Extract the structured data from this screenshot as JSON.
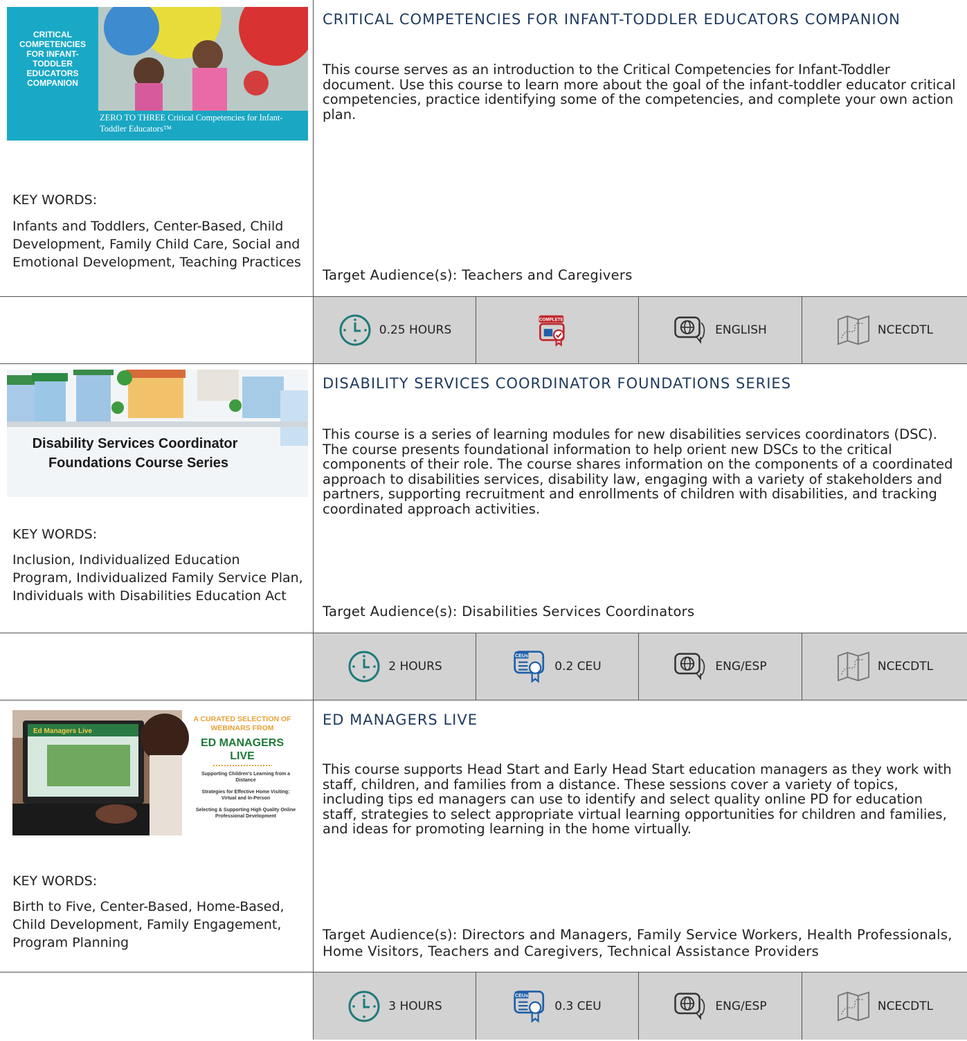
{
  "courses": [
    {
      "thumb": {
        "heading": [
          "CRITICAL",
          "COMPETENCIES",
          "FOR INFANT-",
          "TODDLER",
          "EDUCATORS",
          "COMPANION"
        ],
        "caption": "ZERO TO THREE Critical Competencies for Infant-Toddler Educators™"
      },
      "title": "CRITICAL COMPETENCIES FOR INFANT-TODDLER EDUCATORS COMPANION",
      "description": "This course serves as an introduction to the Critical Competencies for Infant-Toddler document. Use this course to learn more about the goal of the infant-toddler educator critical competencies, practice identifying some of the competencies, and complete your own action plan.",
      "keywords_label": "KEY WORDS:",
      "keywords": "Infants and Toddlers, Center-Based, Child Development, Family Child Care, Social and Emotional Development, Teaching Practices",
      "audience": "Target Audience(s): Teachers and Caregivers",
      "meta": {
        "hours": "0.25 HOURS",
        "credit": "",
        "credit_badge": "COMPLETE",
        "language": "ENGLISH",
        "provider": "NCECDTL"
      }
    },
    {
      "thumb": {
        "heading": [
          "Disability Services Coordinator",
          "Foundations Course Series"
        ]
      },
      "title": "DISABILITY SERVICES COORDINATOR FOUNDATIONS SERIES",
      "description": "This course is a series of learning modules for new disabilities services coordinators (DSC). The course presents foundational information to help orient new DSCs to the critical components of their role. The course shares information on the components of a coordinated approach to disabilities services, disability law, engaging with a variety of stakeholders and partners, supporting recruitment and enrollments of children with disabilities, and tracking coordinated approach activities.",
      "keywords_label": "KEY WORDS:",
      "keywords": "Inclusion, Individualized Education Program, Individualized Family Service Plan, Individuals with Disabilities Education Act",
      "audience": "Target Audience(s): Disabilities Services Coordinators",
      "meta": {
        "hours": "2 HOURS",
        "credit": "0.2 CEU",
        "credit_badge": "CEUs",
        "language": "ENG/ESP",
        "provider": "NCECDTL"
      }
    },
    {
      "thumb": {
        "heading": [
          "A CURATED SELECTION OF",
          "WEBINARS FROM",
          "ED MANAGERS",
          "LIVE"
        ],
        "items": [
          "Supporting Children's Learning from a Distance",
          "Strategies for Effective Home Visiting: Virtual and In-Person",
          "Selecting & Supporting High Quality Online Professional Development"
        ],
        "screen_label": "Ed Managers Live"
      },
      "title": "ED MANAGERS LIVE",
      "description": "This course supports Head Start and Early Head Start education managers as they work with staff, children, and families from a distance. These sessions cover a variety of topics, including tips ed managers can use to identify and select quality online PD for education staff, strategies to select appropriate virtual learning opportunities for children and families, and ideas for promoting learning in the home virtually.",
      "keywords_label": "KEY WORDS:",
      "keywords": "Birth to Five, Center-Based, Home-Based, Child Development, Family Engagement, Program Planning",
      "audience": "Target Audience(s): Directors and Managers, Family Service Workers, Health Professionals, Home Visitors, Teachers and Caregivers, Technical Assistance Providers",
      "meta": {
        "hours": "3 HOURS",
        "credit": "0.3 CEU",
        "credit_badge": "CEUs",
        "language": "ENG/ESP",
        "provider": "NCECDTL"
      }
    }
  ],
  "icons": {
    "clock": "clock-icon",
    "complete_pd": "complete-pd-icon",
    "ceu": "ceu-certificate-icon",
    "language": "globe-speech-icon",
    "provider": "map-icon"
  },
  "colors": {
    "title": "#1e3a5f",
    "teal": "#1f7a7a",
    "meta_bg": "#d2d2d2",
    "ceu_blue": "#1f5fa8",
    "complete_red": "#c0272d"
  }
}
